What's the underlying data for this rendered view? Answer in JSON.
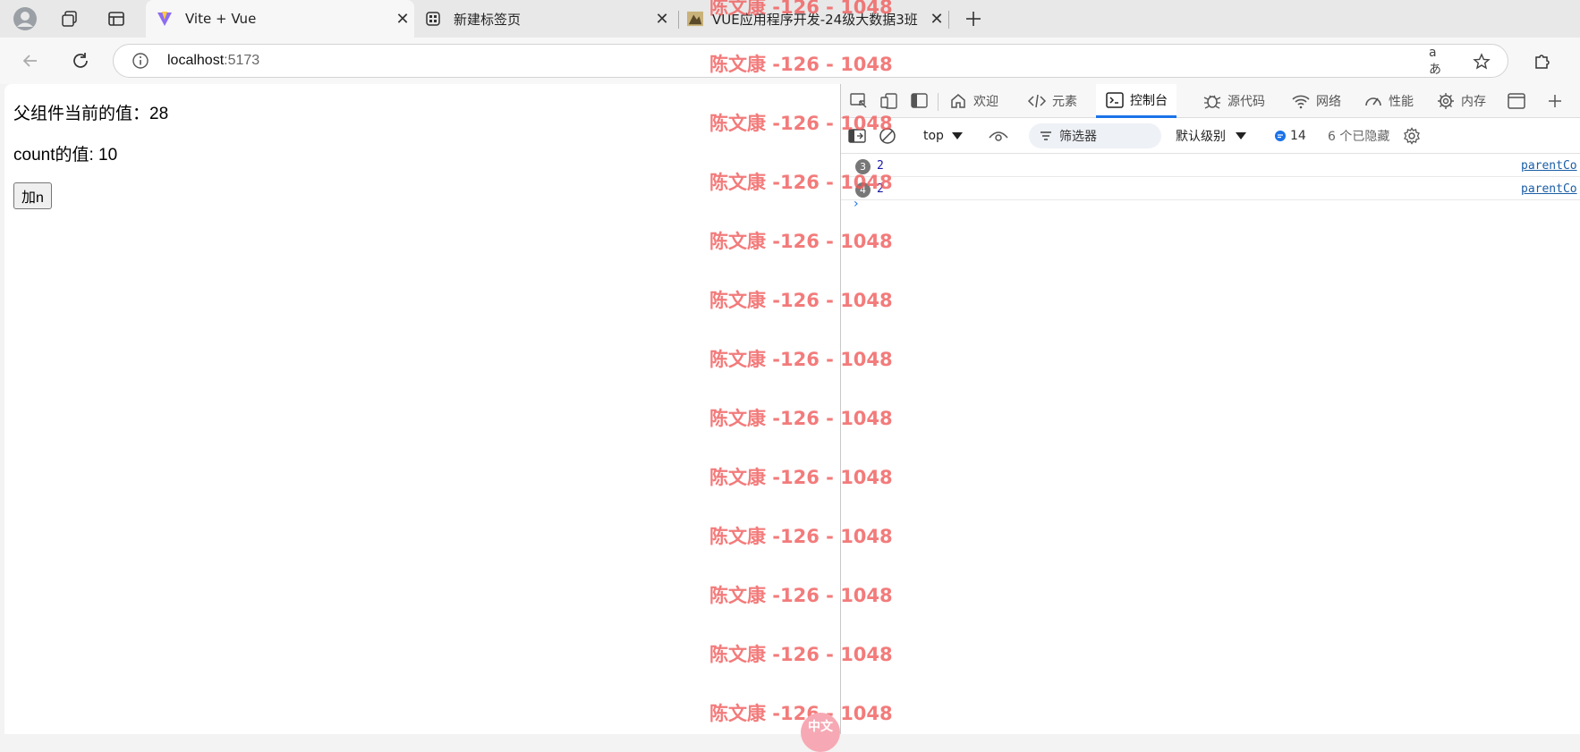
{
  "browser": {
    "tabs": [
      {
        "title": "Vite + Vue",
        "active": true
      },
      {
        "title": "新建标签页",
        "active": false
      },
      {
        "title": "VUE应用程序开发-24级大数据3班",
        "active": false
      }
    ],
    "address": {
      "host": "localhost",
      "port": ":5173"
    }
  },
  "page": {
    "parent_value_line": "父组件当前的值：28",
    "count_line": "count的值: 10",
    "add_button": "加n"
  },
  "devtools": {
    "tabs": {
      "welcome": "欢迎",
      "elements": "元素",
      "console": "控制台",
      "sources": "源代码",
      "network": "网络",
      "performance": "性能",
      "memory": "内存"
    },
    "filterbar": {
      "context": "top",
      "filter_placeholder": "筛选器",
      "level": "默认级别",
      "message_count": "14",
      "hidden": "6 个已隐藏"
    },
    "console_rows": [
      {
        "count": "3",
        "value": "2",
        "source": "parentCo"
      },
      {
        "count": "4",
        "value": "2",
        "source": "parentCo"
      }
    ]
  },
  "watermark": {
    "text": "陈文康 -126 - 1048",
    "ime_label": "中文"
  }
}
